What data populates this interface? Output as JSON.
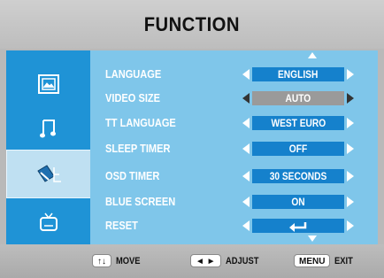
{
  "header": {
    "title": "FUNCTION"
  },
  "sidebar": {
    "items": [
      {
        "icon": "picture-icon",
        "active": false
      },
      {
        "icon": "music-note-icon",
        "active": false
      },
      {
        "icon": "function-tools-icon",
        "active": true
      },
      {
        "icon": "tv-icon",
        "active": false
      }
    ]
  },
  "menu": {
    "rows": [
      {
        "label": "LANGUAGE",
        "value": "ENGLISH"
      },
      {
        "label": "VIDEO SIZE",
        "value": "AUTO",
        "selected": true
      },
      {
        "label": "TT LANGUAGE",
        "value": "WEST EURO"
      },
      {
        "label": "SLEEP TIMER",
        "value": "OFF"
      },
      {
        "label": "OSD TIMER",
        "value": "30 SECONDS"
      },
      {
        "label": "BLUE SCREEN",
        "value": "ON"
      },
      {
        "label": "RESET",
        "value": "",
        "value_icon": "enter-icon"
      }
    ]
  },
  "footer": {
    "move": {
      "key": "↑↓",
      "label": "MOVE"
    },
    "adjust": {
      "key": "◄ ►",
      "label": "ADJUST"
    },
    "exit": {
      "key": "MENU",
      "label": "EXIT"
    }
  },
  "colors": {
    "sidebar": "#1f93d6",
    "content": "#7fc6ea",
    "value_box": "#1581cc",
    "selected_value_box": "#9a9a9a"
  }
}
